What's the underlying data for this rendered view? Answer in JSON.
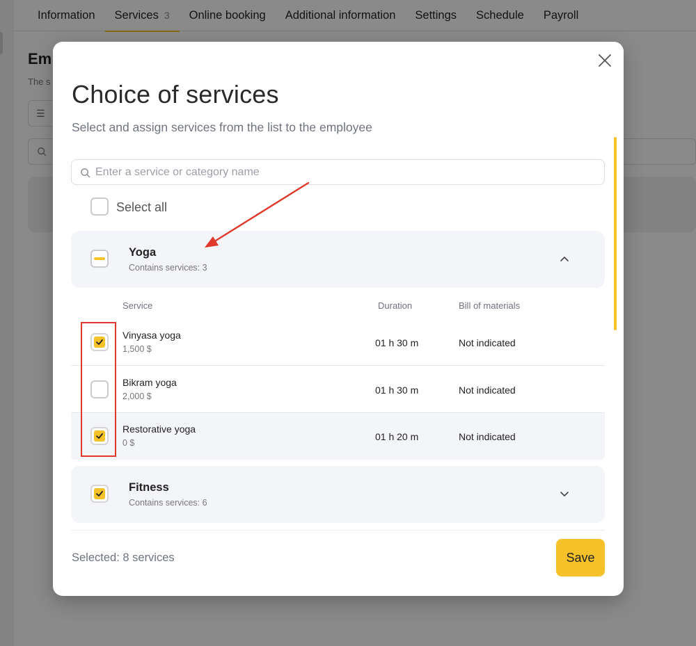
{
  "background": {
    "tabs": [
      {
        "label": "Information"
      },
      {
        "label": "Services",
        "count": "3",
        "active": true
      },
      {
        "label": "Online booking"
      },
      {
        "label": "Additional information"
      },
      {
        "label": "Settings"
      },
      {
        "label": "Schedule"
      },
      {
        "label": "Payroll"
      }
    ],
    "heading_fragment": "Em",
    "subtitle_fragment": "The s"
  },
  "modal": {
    "title": "Choice of services",
    "subtitle": "Select and assign services from the list to the employee",
    "search_placeholder": "Enter a service or category name",
    "select_all_label": "Select all",
    "categories": [
      {
        "name": "Yoga",
        "meta": "Contains services: 3",
        "state": "partial",
        "expanded": true,
        "columns": {
          "service": "Service",
          "duration": "Duration",
          "bom": "Bill of materials"
        },
        "services": [
          {
            "name": "Vinyasa yoga",
            "price": "1,500 $",
            "duration": "01 h 30 m",
            "bom": "Not indicated",
            "checked": true
          },
          {
            "name": "Bikram yoga",
            "price": "2,000 $",
            "duration": "01 h 30 m",
            "bom": "Not indicated",
            "checked": false
          },
          {
            "name": "Restorative yoga",
            "price": "0 $",
            "duration": "01 h 20 m",
            "bom": "Not indicated",
            "checked": true
          }
        ]
      },
      {
        "name": "Fitness",
        "meta": "Contains services: 6",
        "state": "checked",
        "expanded": false
      }
    ],
    "selected_text": "Selected: 8 services",
    "save_label": "Save"
  },
  "colors": {
    "accent": "#f6c22a",
    "annotation": "#e0382b",
    "overlay": "rgba(0,0,0,0.46)"
  },
  "icons": {
    "close": "close-icon",
    "search": "search-icon",
    "check": "check-icon",
    "chevron_up": "chevron-up-icon",
    "chevron_down": "chevron-down-icon"
  }
}
